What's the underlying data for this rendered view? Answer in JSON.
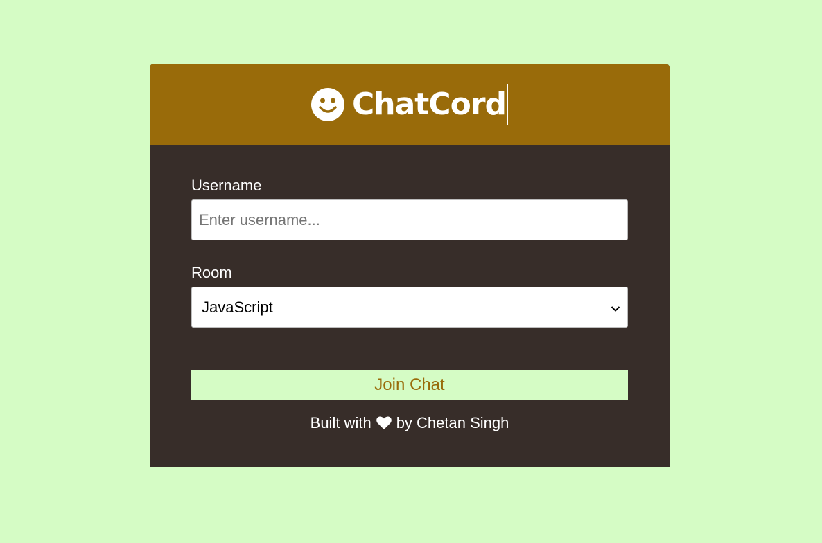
{
  "colors": {
    "page_bg": "#d5fcc5",
    "header_bg": "#996b0a",
    "card_bg": "#372d29",
    "button_text": "#996b0a"
  },
  "header": {
    "icon": "smile-icon",
    "title": "ChatCord"
  },
  "form": {
    "username_label": "Username",
    "username_placeholder": "Enter username...",
    "username_value": "",
    "room_label": "Room",
    "room_selected": "JavaScript",
    "join_label": "Join Chat"
  },
  "footer": {
    "prefix": "Built with",
    "icon": "heart-icon",
    "suffix": "by Chetan Singh"
  }
}
